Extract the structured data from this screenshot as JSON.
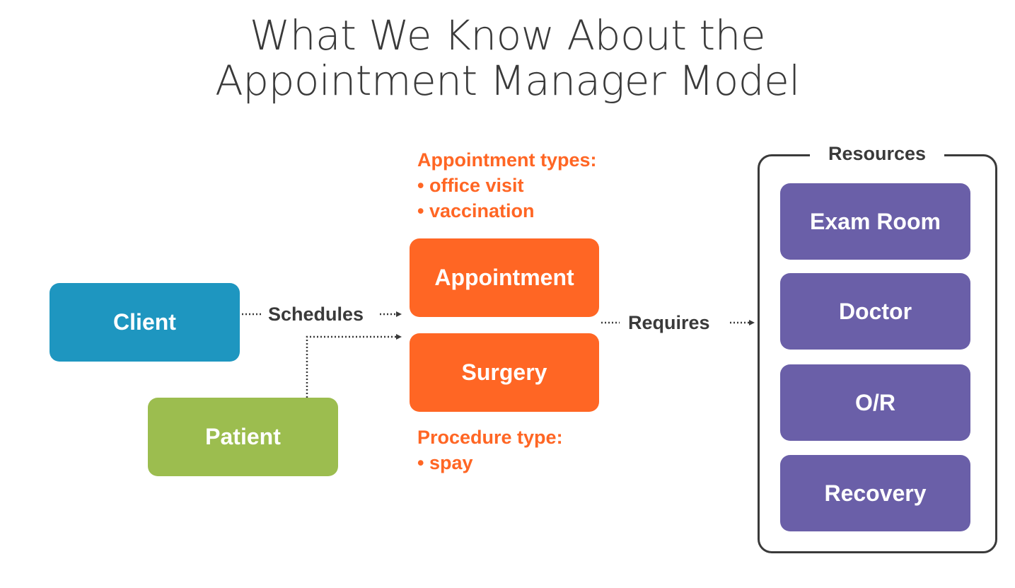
{
  "title": {
    "line1": "What We Know About the",
    "line2": "Appointment Manager Model"
  },
  "entities": {
    "client": "Client",
    "patient": "Patient",
    "appointment": "Appointment",
    "surgery": "Surgery"
  },
  "relations": {
    "schedules": "Schedules",
    "requires": "Requires"
  },
  "appointment_types": {
    "heading": "Appointment types:",
    "items": [
      "• office visit",
      "• vaccination"
    ]
  },
  "procedure_types": {
    "heading": "Procedure type:",
    "items": [
      "• spay"
    ]
  },
  "resources": {
    "title": "Resources",
    "items": [
      "Exam Room",
      "Doctor",
      "O/R",
      "Recovery"
    ]
  },
  "colors": {
    "client": "#1e96c0",
    "patient": "#9cbd4f",
    "appointment": "#ff6624",
    "resource": "#6a5fa8",
    "text": "#3a3a3a"
  }
}
